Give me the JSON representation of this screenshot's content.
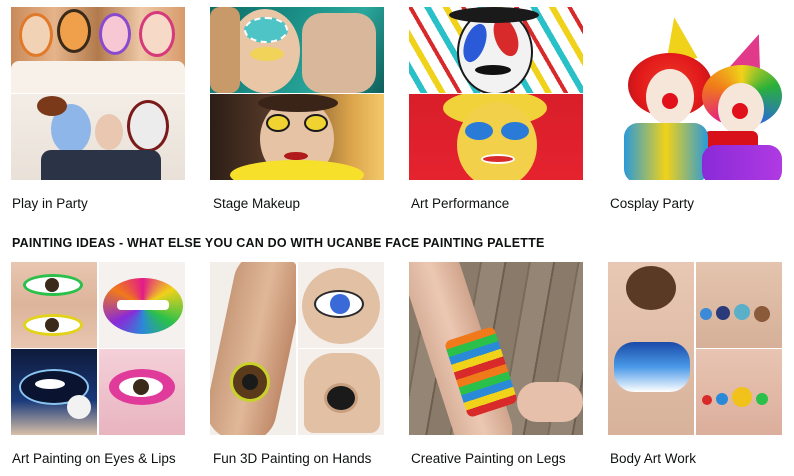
{
  "top_row": [
    {
      "caption": "Play in Party"
    },
    {
      "caption": "Stage Makeup"
    },
    {
      "caption": "Art Performance"
    },
    {
      "caption": "Cosplay Party"
    }
  ],
  "section_heading": "PAINTING IDEAS - WHAT ELSE YOU CAN DO WITH UCANBE FACE PAINTING PALETTE",
  "bottom_row": [
    {
      "caption": "Art Painting on Eyes & Lips"
    },
    {
      "caption": "Fun 3D Painting on Hands"
    },
    {
      "caption": "Creative Painting on Legs"
    },
    {
      "caption": "Body Art Work"
    }
  ]
}
